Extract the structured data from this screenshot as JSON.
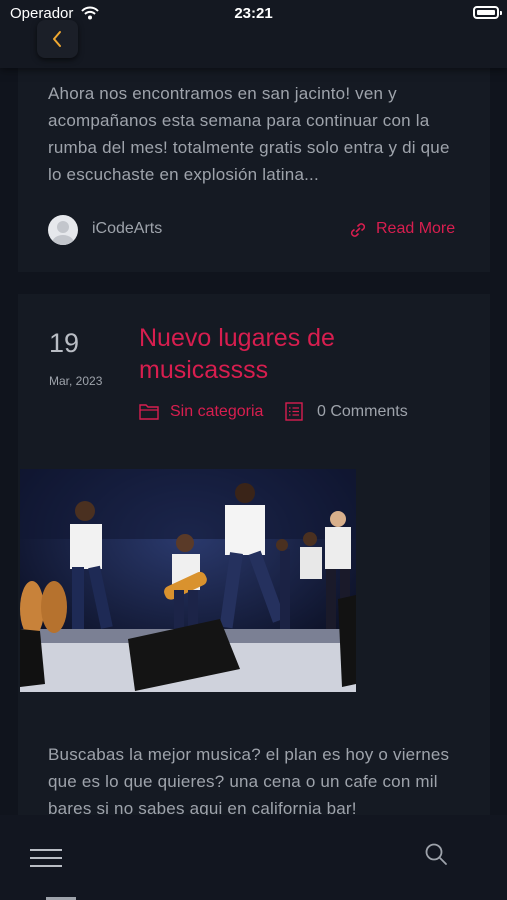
{
  "status_bar": {
    "carrier": "Operador",
    "time": "23:21"
  },
  "post1": {
    "excerpt": "Ahora nos encontramos en san jacinto! ven y acompañanos esta semana para continuar con la rumba del mes! totalmente gratis solo entra y di que lo escuchaste en explosión latina...",
    "author": "iCodeArts",
    "read_more": "Read More"
  },
  "post2": {
    "day": "19",
    "date": "Mar, 2023",
    "title": "Nuevo lugares de musicassss",
    "category": "Sin categoria",
    "comments": "0 Comments",
    "excerpt": "Buscabas la mejor musica? el plan es hoy o viernes que es lo que quieres? una cena o un cafe con mil bares si no sabes aqui en california bar!"
  },
  "colors": {
    "accent": "#d81e4f",
    "background": "#10141d",
    "card": "#151a23"
  },
  "icons": [
    "wifi-icon",
    "battery-icon",
    "back-chevron-icon",
    "link-icon",
    "folder-icon",
    "list-icon",
    "menu-icon",
    "search-icon"
  ]
}
